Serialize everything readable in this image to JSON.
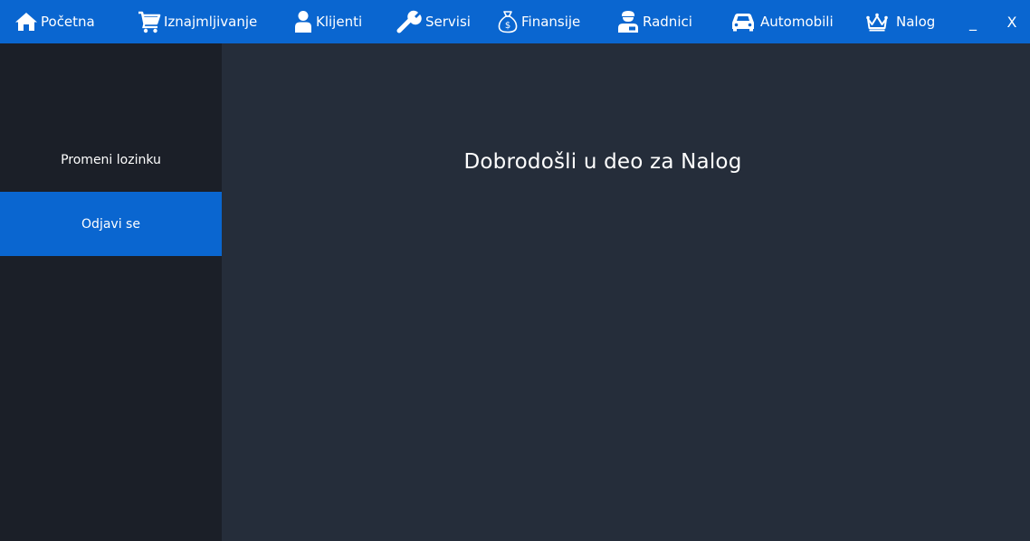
{
  "nav": {
    "items": [
      {
        "label": "Početna",
        "icon": "home-icon"
      },
      {
        "label": "Iznajmljivanje",
        "icon": "cart-icon"
      },
      {
        "label": "Klijenti",
        "icon": "user-icon"
      },
      {
        "label": "Servisi",
        "icon": "wrench-icon"
      },
      {
        "label": "Finansije",
        "icon": "money-bag-icon"
      },
      {
        "label": "Radnici",
        "icon": "worker-icon"
      },
      {
        "label": "Automobili",
        "icon": "car-icon"
      },
      {
        "label": "Nalog",
        "icon": "crown-icon"
      }
    ]
  },
  "window": {
    "minimize_label": "_",
    "close_label": "X"
  },
  "sidebar": {
    "items": [
      {
        "label": "Promeni lozinku",
        "active": false
      },
      {
        "label": "Odjavi se",
        "active": true
      }
    ]
  },
  "main": {
    "welcome_text": "Dobrodošli u deo za Nalog"
  },
  "colors": {
    "topbar": "#0a66d0",
    "sidebar": "#1b1f28",
    "main": "#252d3a",
    "active": "#0a66d0",
    "text": "#ffffff"
  }
}
